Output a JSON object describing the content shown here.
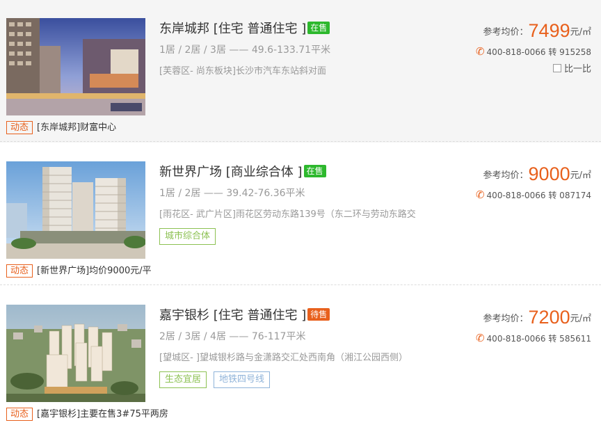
{
  "listings": [
    {
      "name": "东岸城邦",
      "type": "[住宅 普通住宅 ]",
      "status": "在售",
      "status_color": "#2db82d",
      "layout": "1居 / 2居 / 3居 —— 49.6-133.71平米",
      "address": "[芙蓉区- 尚东板块]长沙市汽车东站斜对面",
      "tags": [],
      "price_label": "参考均价：",
      "price": "7499",
      "price_unit": "元/㎡",
      "phone": "400-818-0066 转 915258",
      "compare_label": "比一比",
      "news_label": "动态",
      "news_text": "[东岸城邦]财富中心"
    },
    {
      "name": "新世界广场",
      "type": "[商业综合体 ]",
      "status": "在售",
      "status_color": "#2db82d",
      "layout": "1居 / 2居 —— 39.42-76.36平米",
      "address": "[雨花区- 武广片区]雨花区劳动东路139号（东二环与劳动东路交",
      "tags": [
        {
          "label": "城市综合体",
          "color": "#8cc152"
        }
      ],
      "price_label": "参考均价：",
      "price": "9000",
      "price_unit": "元/㎡",
      "phone": "400-818-0066 转 087174",
      "news_label": "动态",
      "news_text": "[新世界广场]均价9000元/平"
    },
    {
      "name": "嘉宇银杉",
      "type": "[住宅 普通住宅 ]",
      "status": "待售",
      "status_color": "#e8601c",
      "layout": "2居 / 3居 / 4居 —— 76-117平米",
      "address": "[望城区- ]望城银杉路与金潇路交汇处西南角（湘江公园西侧）",
      "tags": [
        {
          "label": "生态宜居",
          "color": "#8cc152"
        },
        {
          "label": "地铁四号线",
          "color": "#8fb3d9"
        }
      ],
      "price_label": "参考均价：",
      "price": "7200",
      "price_unit": "元/㎡",
      "phone": "400-818-0066 转 585611",
      "news_label": "动态",
      "news_text": "[嘉宇银杉]主要在售3#75平两房"
    }
  ]
}
